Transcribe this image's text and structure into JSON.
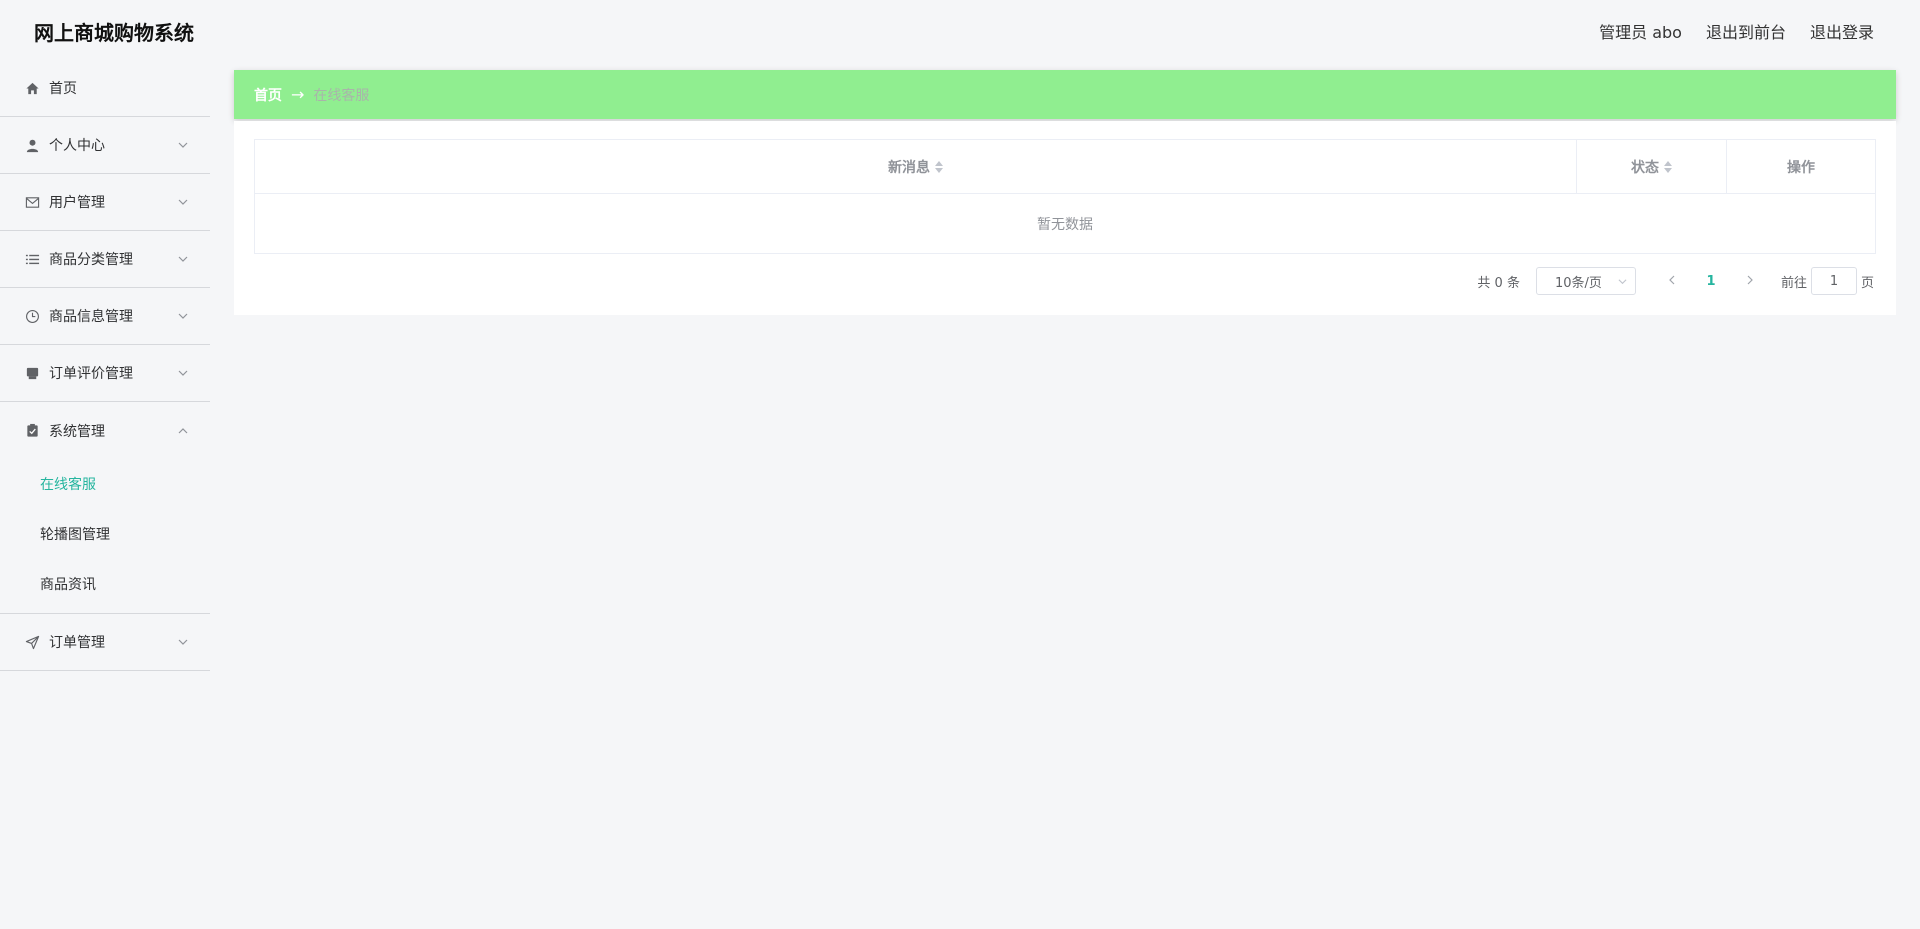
{
  "app": {
    "title": "网上商城购物系统"
  },
  "header": {
    "user_label": "管理员 abo",
    "front_label": "退出到前台",
    "logout_label": "退出登录"
  },
  "sidebar": {
    "items": [
      {
        "label": "首页",
        "icon": "home-icon"
      },
      {
        "label": "个人中心",
        "icon": "user-icon"
      },
      {
        "label": "用户管理",
        "icon": "mail-icon"
      },
      {
        "label": "商品分类管理",
        "icon": "list-icon"
      },
      {
        "label": "商品信息管理",
        "icon": "clock-icon"
      },
      {
        "label": "订单评价管理",
        "icon": "printer-icon"
      },
      {
        "label": "系统管理",
        "icon": "clipboard-check-icon"
      },
      {
        "label": "订单管理",
        "icon": "send-icon"
      }
    ],
    "system_submenu": [
      {
        "label": "在线客服",
        "active": true
      },
      {
        "label": "轮播图管理"
      },
      {
        "label": "商品资讯"
      }
    ]
  },
  "breadcrumb": {
    "home": "首页",
    "current": "在线客服"
  },
  "table": {
    "columns": [
      "新消息",
      "状态",
      "操作"
    ],
    "empty_text": "暂无数据"
  },
  "pagination": {
    "total_text": "共 0 条",
    "page_size": "10条/页",
    "current_page": "1",
    "goto_label": "前往",
    "goto_value": "1",
    "page_suffix": "页"
  },
  "colors": {
    "accent": "#26b59f",
    "breadcrumb_bg": "#90ee90",
    "page_bg": "#f5f6f8"
  }
}
